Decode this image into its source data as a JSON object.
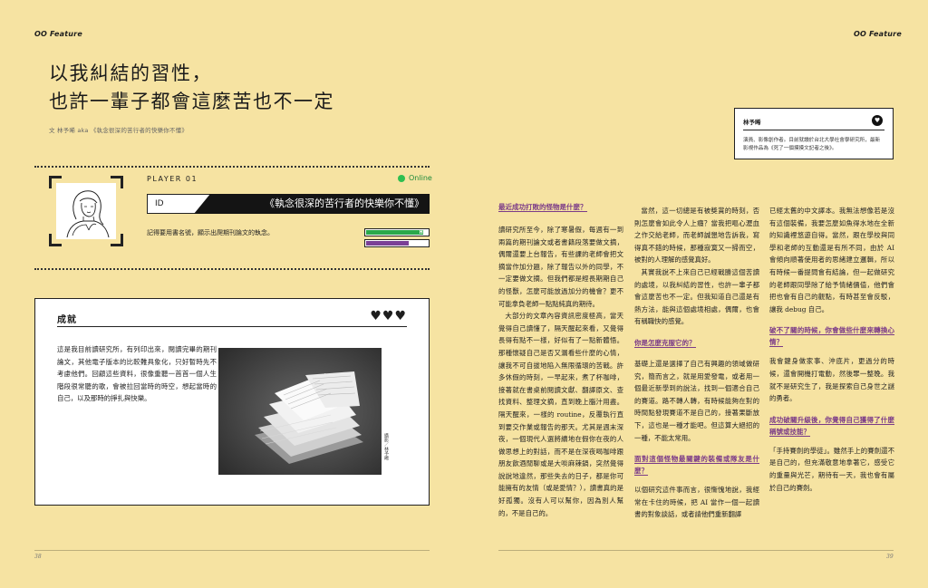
{
  "header": {
    "left": "OO Feature",
    "right": "OO Feature"
  },
  "title": {
    "line1": "以我糾結的習性，",
    "line2": "也許一輩子都會這麼苦也不一定"
  },
  "byline": "文 林予晞 aka 《執念很深的苦行者的快樂你不懂》",
  "player": {
    "label": "PLAYER  01",
    "status": "Online",
    "id_label": "ID",
    "id_value": "《執念很深的苦行者的快樂你不懂》",
    "bio": "記得要用書名號，顯示出爬期刊論文的執念。",
    "hp_label": "HP",
    "hp_level": 0.93,
    "mp_label": "MP",
    "mp_level": 0.7,
    "colors": {
      "hp": "#2aa84a",
      "mp": "#7a3f96",
      "online": "#2fbf50"
    }
  },
  "achievement": {
    "title": "成就",
    "hearts": "♥♥♥",
    "text": "這是我目前讀研究所，有列印出來，閱讀完畢的期刊論文，其他電子版本的比較難具象化，只好暫時先不考慮他們。回顧這些資料，很像重聽一首首一個人生階段很常聽的歌，會被拉回當時的時空，想起當時的自己，以及那時的掙扎與快樂。",
    "photo_credit": "攝影／林予晞"
  },
  "info": {
    "name": "林予晞",
    "icon": "heart-icon",
    "desc": "演員、影像創作者。目前就讀於台北大學社會學研究所，最新影視作品為《死了一個摸摸文記者之後》。"
  },
  "columns": {
    "c1": {
      "q1": "最近成功打敗的怪物是什麼？",
      "p1": "讀研究所至今，除了寒暑假，每週有一到兩篇的期刊論文或者書籍段落要做文摘，偶爾還要上台報告，有些課的老師會把文摘當作加分題，除了報告以外的同學，不一定要做文摘。但我們都是經長期期自己的怪獸，怎麼可能放過加分的機會？更不可能拿負老師一點點純真的期待。",
      "p2": "大部分的文章內容資訊密度極高，當天覺得自己讀懂了，隔天醒起來看，又覺得長得有點不一樣，好似有了一點新體悟。那種懷疑自己是否又漏看些什麼的心情，讓我不可自拔地陷入無限循環的苦戰。許多休假的時刻，一早起來，煮了杯咖啡，接著就在書桌前閱讀文獻、翻譯原文、查找資料、整理文摘，直到晚上腦汁用盡。隔天醒來，一樣的 routine，反覆執行直到要交作業或報告的那天。尤其是週末深夜，一個現代人選將續地在假你在夜的人做思想上的對話，而不是在深夜喝咖啡跟朋友飲酒閒聊或是大啖麻辣鍋，突然覺得說說地違然，那些失去的日子，都是你可能擁有的友情（或是愛情？），讀書真的是好孤獨。沒有人可以幫你，因為別人幫的，不是自己的。"
    },
    "c2": {
      "p1": "當然，這一切總是有被獎賞的時刻，否則怎麼會如此令人上癮？當我把嘔心瀝血之作交給老師，而老師誠懇地告訴我，寫得真不錯的時候，那種寂寞又一掃而空，被對的人理解的感覺真好。",
      "p2": "其實我說不上來自己已經戰勝這個苦讀的處境，以我糾結的習性，也許一輩子都會這麼苦也不一定。但我知道自己還是有熱方法，能與這個處境相處，偶爾，也會有稱職快的感覺。",
      "q2": "你是怎麼克服它的？",
      "p3": "基礎上還是選擇了自己有興趣的領域做研究，簡而言之，就是用愛發電，或者用一個最近新學到的說法，找到一個適合自己的賽道。路不轉人轉，有時候能夠在對的時間點發現賽道不是自己的，接著果斷放下，這也是一種才能吧。但這算大絕招的一種，不能太常用。",
      "q3": "面對這個怪物最關鍵的裝備或隊友是什麼？",
      "p4": "以個研究這件事而言，很慚愧地說，我經常在卡住的時候，把 AI 當作一個一起讀書的對象談話，或者請他們重新翻譯"
    },
    "c3": {
      "p1": "已經太舊的中文譯本。我無法想像若是沒有這個裝備，我要怎麼如魚得水地在全新的知識裡悠遊自得。當然，跟在學校與同學和老師的互動還是有所不同，由於 AI 會傾向順著使用者的思緒建立邏輯，所以有時候一番提問會有結論，但一起做研究的老師跟同學除了給予情緒價值，他們會把也會有自己的觀點，有時甚至會反駁，讓我 debug 自己。",
      "q4": "破不了關的時候，你會做些什麼來轉換心情？",
      "p2": "我會鍵身做家事、沖底片，更過分的時候，還會開機打電動，然後罪一整晚。我就不是研究生了，我是探索自己身世之謎的勇者。",
      "q5": "成功破關升級後，你覺得自己獲得了什麼稱號或技能？",
      "p3": "「手持賽劍的學徒」。雖然手上的賽劍還不是自己的，但充滿敬意地拿著它，感受它的重量與光芒，期待有一天，我也會有屬於自己的賽劍。"
    }
  },
  "page_numbers": {
    "left": "38",
    "right": "39"
  }
}
